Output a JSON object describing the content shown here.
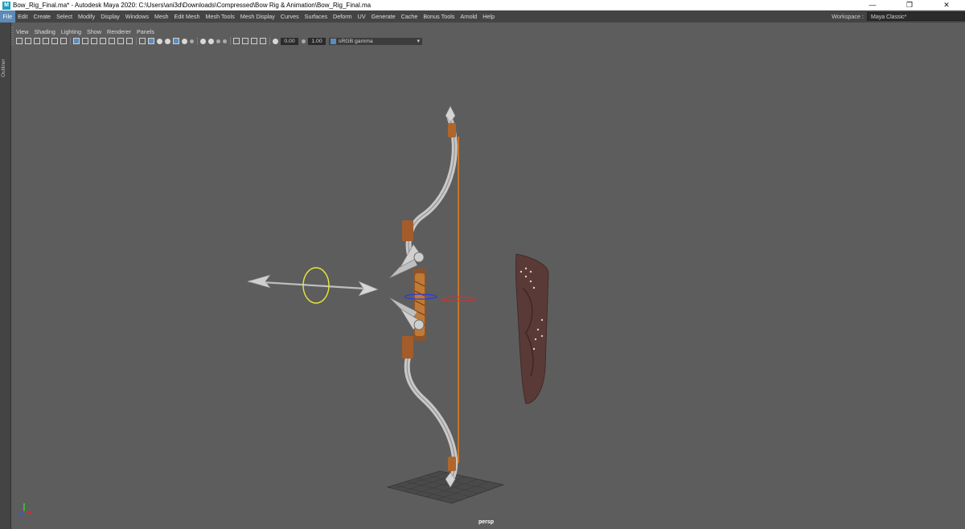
{
  "titlebar": {
    "title": "Bow_Rig_Final.ma* - Autodesk Maya 2020: C:\\Users\\ani3d\\Downloads\\Compressed\\Bow Rig & Animation\\Bow_Rig_Final.ma",
    "app_icon_glyph": "M",
    "minimize_glyph": "—",
    "restore_glyph": "❐",
    "close_glyph": "✕"
  },
  "menubar": {
    "items": [
      "File",
      "Edit",
      "Create",
      "Select",
      "Modify",
      "Display",
      "Windows",
      "Mesh",
      "Edit Mesh",
      "Mesh Tools",
      "Mesh Display",
      "Curves",
      "Surfaces",
      "Deform",
      "UV",
      "Generate",
      "Cache",
      "Bonus Tools",
      "Arnold",
      "Help"
    ],
    "active_index": 0,
    "workspace_label": "Workspace :",
    "workspace_value": "Maya Classic*"
  },
  "outliner": {
    "label": "Outliner"
  },
  "panel_menu": {
    "items": [
      "View",
      "Shading",
      "Lighting",
      "Show",
      "Renderer",
      "Panels"
    ]
  },
  "toolbar": {
    "exposure_value": "0.00",
    "gamma_value": "1.00",
    "color_space": "sRGB gamma",
    "dropdown_chevron": "▾"
  },
  "viewport": {
    "camera_label": "persp"
  },
  "colors": {
    "viewport_bg": "#5d5d5d",
    "menu_bg": "#444444",
    "accent_blue": "#5d8bb5",
    "bow_string": "#e07a1a",
    "arrow_control": "#e8e83a",
    "quiver": "#5a3a36"
  }
}
